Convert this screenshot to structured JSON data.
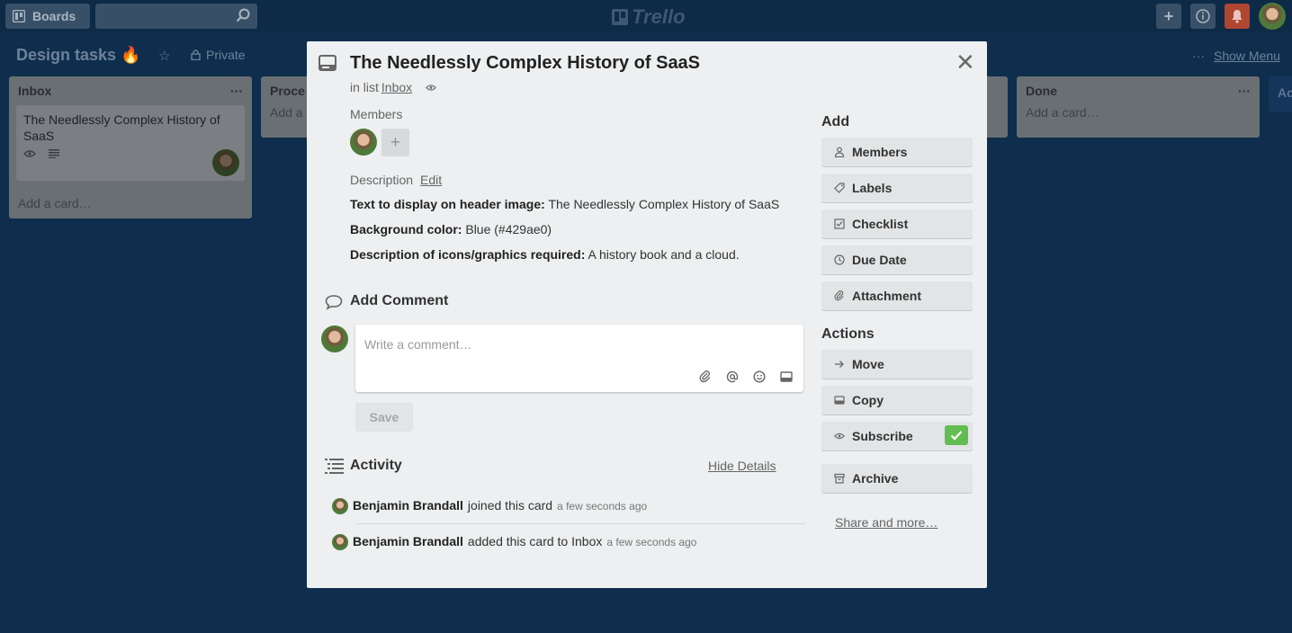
{
  "topbar": {
    "boards_label": "Boards",
    "logo_text": "Trello"
  },
  "board": {
    "title": "Design tasks 🔥",
    "visibility": "Private",
    "menu_ellipsis": "···",
    "show_menu": "Show Menu"
  },
  "lists": {
    "inbox": {
      "title": "Inbox",
      "menu": "···",
      "card_title": "The Needlessly Complex History of SaaS",
      "add_card": "Add a card…"
    },
    "process": {
      "title": "Proce",
      "add_card": "Add a"
    },
    "done": {
      "title": "Done",
      "menu": "···",
      "add_card": "Add a card…"
    },
    "edge": {
      "title": "Ac"
    }
  },
  "modal": {
    "title": "The Needlessly Complex History of SaaS",
    "in_list_prefix": "in list",
    "list_name": "Inbox",
    "members_label": "Members",
    "add_member": "+",
    "description_label": "Description",
    "edit_label": "Edit",
    "description": [
      {
        "label": "Text to display on header image:",
        "value": "The Needlessly Complex History of SaaS"
      },
      {
        "label": "Background color:",
        "value": "Blue (#429ae0)"
      },
      {
        "label": "Description of icons/graphics required:",
        "value": "A history book and a cloud."
      }
    ],
    "add_comment_title": "Add Comment",
    "comment_placeholder": "Write a comment…",
    "save_label": "Save",
    "activity_title": "Activity",
    "hide_details": "Hide Details",
    "activity": [
      {
        "user": "Benjamin Brandall",
        "action": "joined this card",
        "time": "a few seconds ago"
      },
      {
        "user": "Benjamin Brandall",
        "action": "added this card to Inbox",
        "time": "a few seconds ago"
      }
    ]
  },
  "sidebar": {
    "add_title": "Add",
    "add_buttons": [
      "Members",
      "Labels",
      "Checklist",
      "Due Date",
      "Attachment"
    ],
    "actions_title": "Actions",
    "action_buttons": [
      "Move",
      "Copy",
      "Subscribe",
      "Archive"
    ],
    "share_link": "Share and more…"
  },
  "colors": {
    "board_bg": "#0f2e4d",
    "modal_bg": "#edeff0",
    "button_bg": "#e2e4e6",
    "subscribed_green": "#61bd4f",
    "notification_red": "#b04632"
  }
}
